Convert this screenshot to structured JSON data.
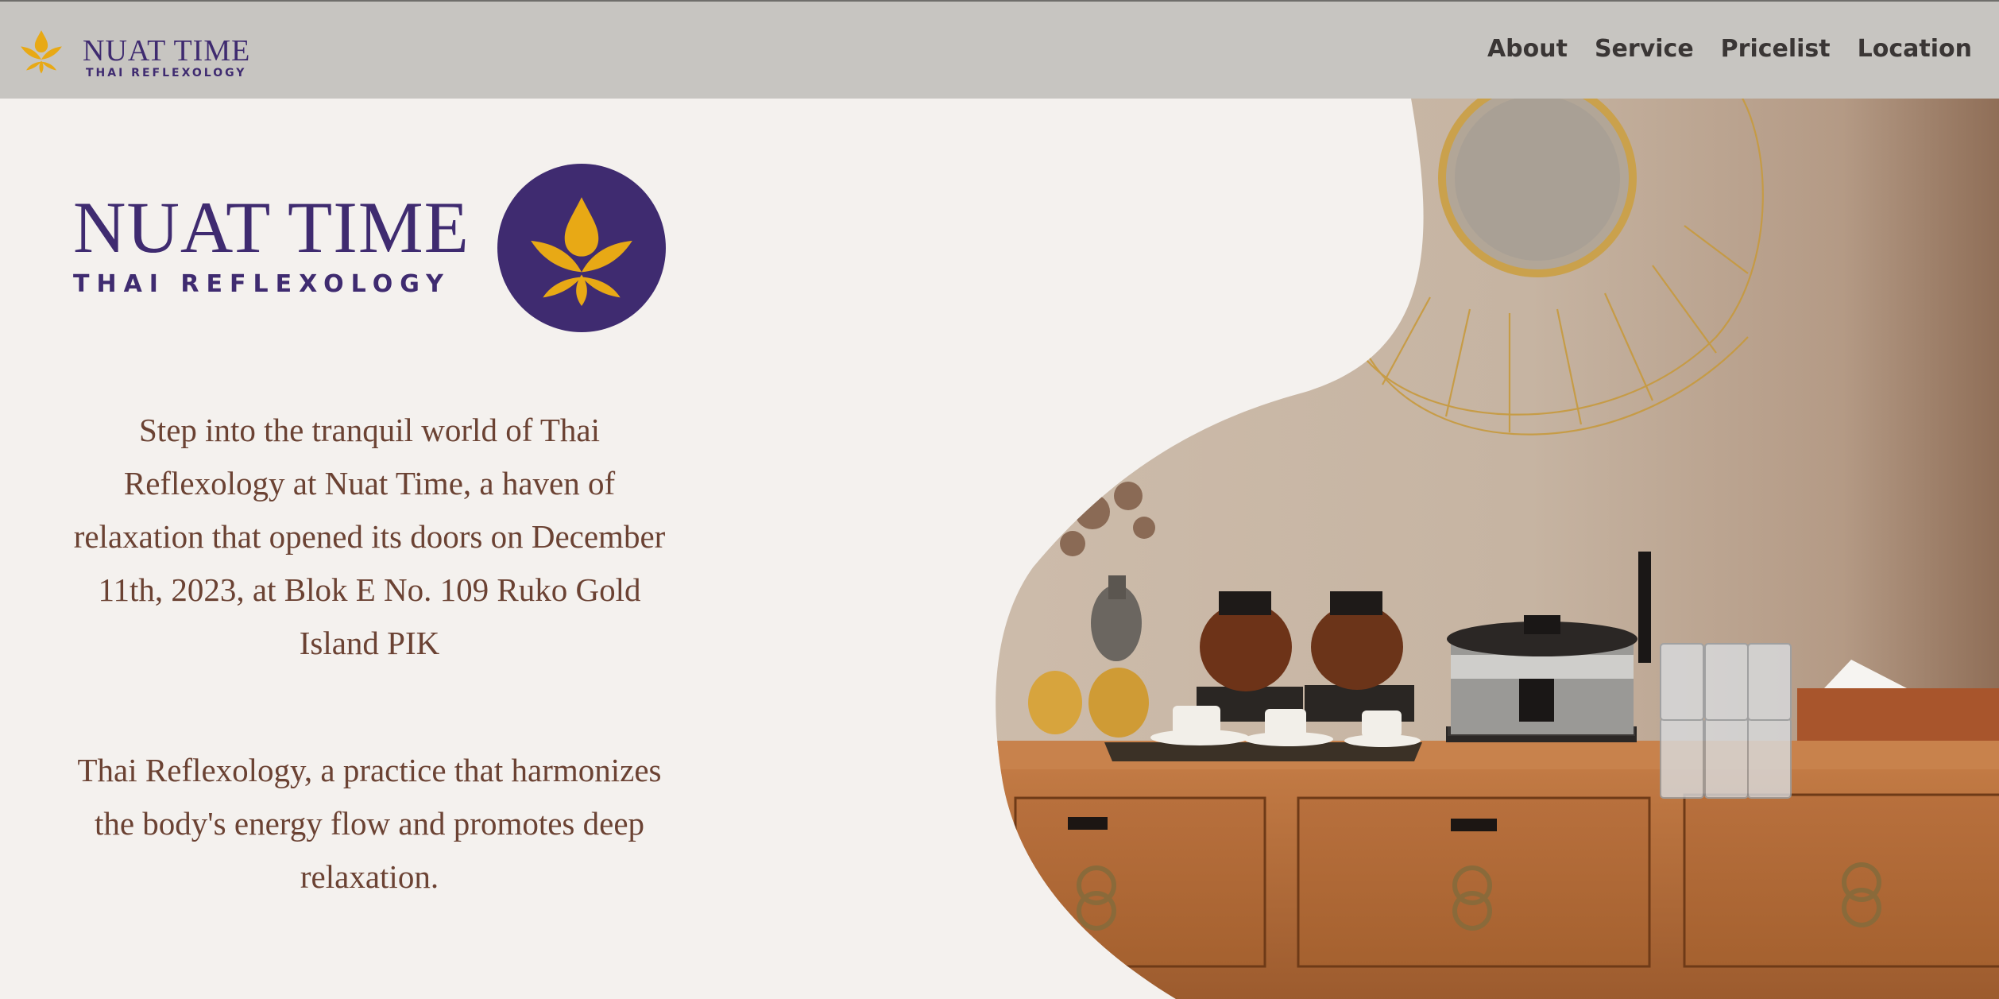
{
  "header": {
    "brand_name": "NUAT TIME",
    "brand_tagline": "THAI REFLEXOLOGY",
    "nav": [
      {
        "label": "About"
      },
      {
        "label": "Service"
      },
      {
        "label": "Pricelist"
      },
      {
        "label": "Location"
      }
    ]
  },
  "hero": {
    "logo_name": "NUAT TIME",
    "logo_tagline": "THAI REFLEXOLOGY",
    "paragraph_1": "Step into the tranquil world of Thai Reflexology at Nuat Time, a haven of relaxation that opened its doors on December 11th, 2023, at Blok E No. 109 Ruko Gold Island PIK",
    "paragraph_2": "Thai Reflexology, a practice that harmonizes the body's energy flow and promotes deep relaxation."
  },
  "colors": {
    "brand_purple": "#3f2b70",
    "lotus_gold": "#e8a915",
    "header_bg": "#c7c5c1",
    "page_bg": "#f4f1ee",
    "text_brown": "#6b4233"
  },
  "icons": {
    "brand_logo": "lotus-icon",
    "hero_badge": "lotus-badge-icon"
  }
}
